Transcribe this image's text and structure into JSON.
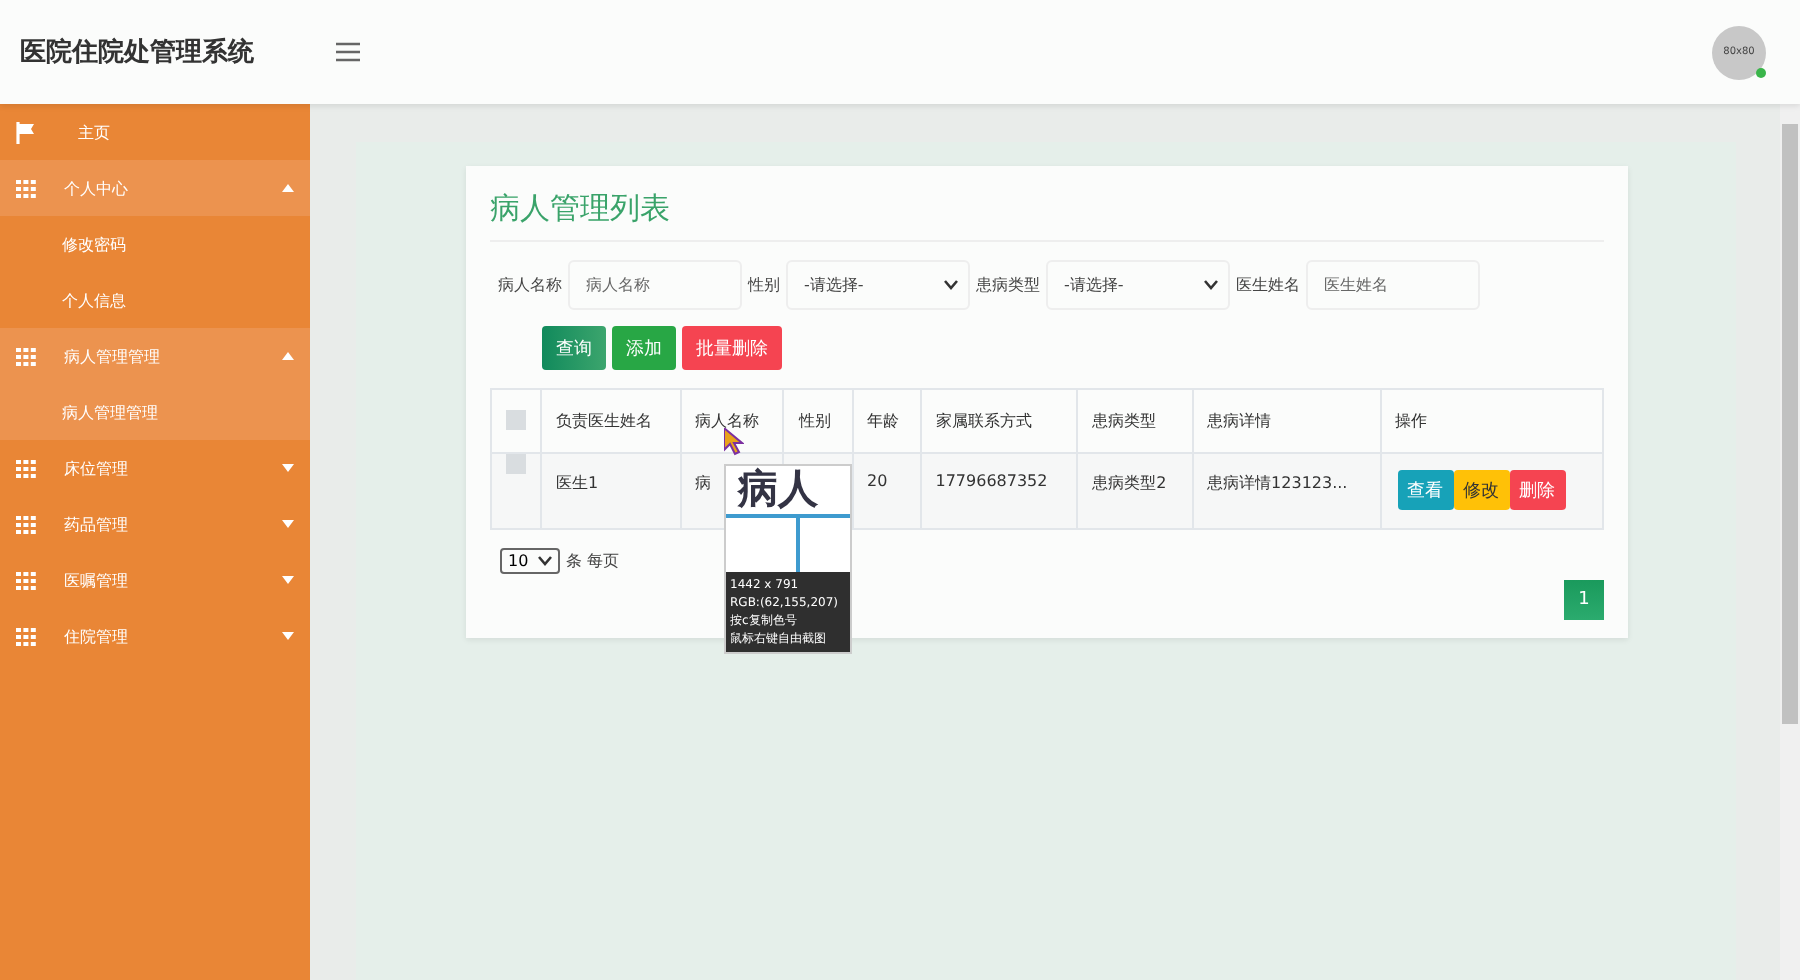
{
  "app_title": "医院住院处管理系统",
  "avatar": {
    "label": "80x80",
    "online": true
  },
  "sidebar": {
    "items": [
      {
        "kind": "home",
        "label": "主页",
        "expanded": false
      },
      {
        "kind": "group",
        "label": "个人中心",
        "expanded": true,
        "children": [
          {
            "label": "修改密码",
            "selected": false
          },
          {
            "label": "个人信息",
            "selected": false
          }
        ]
      },
      {
        "kind": "group",
        "label": "病人管理管理",
        "expanded": true,
        "children": [
          {
            "label": "病人管理管理",
            "selected": true
          }
        ]
      },
      {
        "kind": "group",
        "label": "床位管理",
        "expanded": false
      },
      {
        "kind": "group",
        "label": "药品管理",
        "expanded": false
      },
      {
        "kind": "group",
        "label": "医嘱管理",
        "expanded": false
      },
      {
        "kind": "group",
        "label": "住院管理",
        "expanded": false
      }
    ]
  },
  "panel": {
    "title": "病人管理列表",
    "filters": [
      {
        "kind": "input",
        "label": "病人名称",
        "placeholder": "病人名称"
      },
      {
        "kind": "select",
        "label": "性别",
        "value": "-请选择-"
      },
      {
        "kind": "select",
        "label": "患病类型",
        "value": "-请选择-"
      },
      {
        "kind": "input",
        "label": "医生姓名",
        "placeholder": "医生姓名"
      }
    ],
    "buttons": [
      {
        "kind": "search",
        "label": "查询"
      },
      {
        "kind": "add",
        "label": "添加"
      },
      {
        "kind": "delete",
        "label": "批量删除"
      }
    ],
    "table": {
      "all_checked": false,
      "columns": [
        "负责医生姓名",
        "病人名称",
        "性别",
        "年龄",
        "家属联系方式",
        "患病类型",
        "患病详情",
        "操作"
      ],
      "rows": [
        {
          "checked": false,
          "cells": [
            "医生1",
            "病",
            "",
            "20",
            "17796687352",
            "患病类型2",
            "患病详情123123..."
          ],
          "actions": [
            {
              "kind": "view",
              "label": "查看"
            },
            {
              "kind": "edit",
              "label": "修改"
            },
            {
              "kind": "delete",
              "label": "删除"
            }
          ]
        }
      ]
    },
    "page_size": {
      "value": "10",
      "suffix": "条 每页"
    },
    "pagination": [
      {
        "label": "1",
        "selected": true
      }
    ]
  },
  "color_picker": {
    "magnified_text": "病人",
    "lines": [
      "1442 x 791",
      "RGB:(62,155,207)",
      "按c复制色号",
      "鼠标右键自由截图"
    ]
  }
}
